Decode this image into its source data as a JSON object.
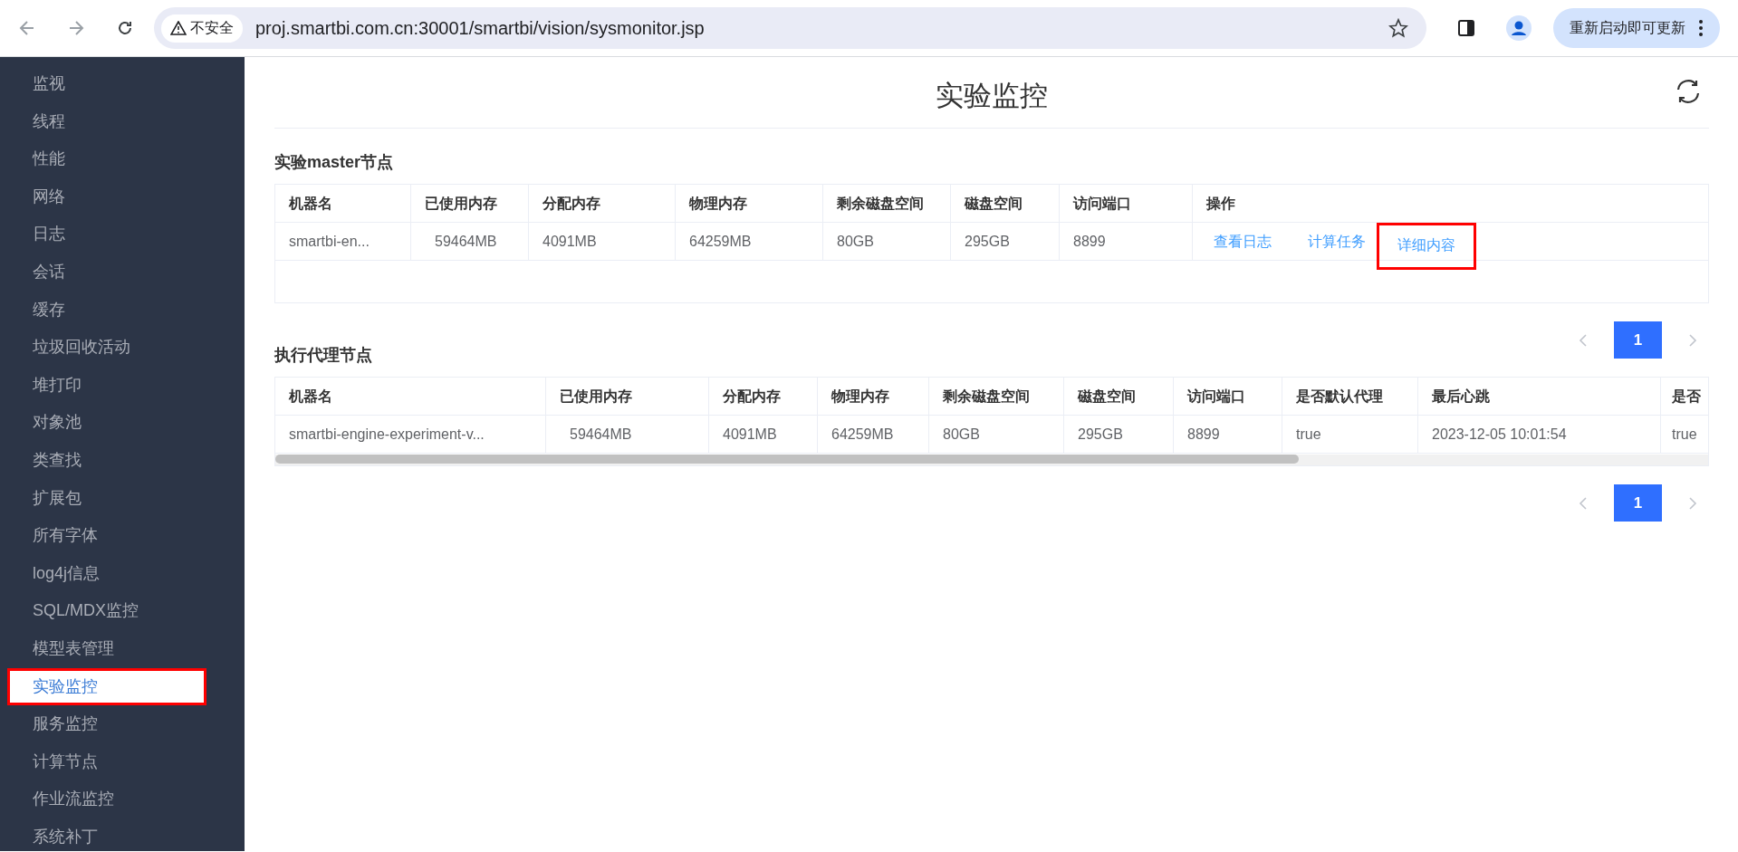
{
  "browser": {
    "security_label": "不安全",
    "url": "proj.smartbi.com.cn:30001/smartbi/vision/sysmonitor.jsp",
    "update_button": "重新启动即可更新"
  },
  "sidebar": {
    "items": [
      {
        "label": "监视",
        "selected": false
      },
      {
        "label": "线程",
        "selected": false
      },
      {
        "label": "性能",
        "selected": false
      },
      {
        "label": "网络",
        "selected": false
      },
      {
        "label": "日志",
        "selected": false
      },
      {
        "label": "会话",
        "selected": false
      },
      {
        "label": "缓存",
        "selected": false
      },
      {
        "label": "垃圾回收活动",
        "selected": false
      },
      {
        "label": "堆打印",
        "selected": false
      },
      {
        "label": "对象池",
        "selected": false
      },
      {
        "label": "类查找",
        "selected": false
      },
      {
        "label": "扩展包",
        "selected": false
      },
      {
        "label": "所有字体",
        "selected": false
      },
      {
        "label": "log4j信息",
        "selected": false
      },
      {
        "label": "SQL/MDX监控",
        "selected": false
      },
      {
        "label": "模型表管理",
        "selected": false
      },
      {
        "label": "实验监控",
        "selected": true,
        "highlighted": true
      },
      {
        "label": "服务监控",
        "selected": false
      },
      {
        "label": "计算节点",
        "selected": false
      },
      {
        "label": "作业流监控",
        "selected": false
      },
      {
        "label": "系统补丁",
        "selected": false
      }
    ]
  },
  "page_title": "实验监控",
  "master_section": {
    "title": "实验master节点",
    "columns": [
      "机器名",
      "已使用内存",
      "分配内存",
      "物理内存",
      "剩余磁盘空间",
      "磁盘空间",
      "访问端口",
      "操作"
    ],
    "rows": [
      {
        "cells": [
          "smartbi-en...",
          "59464MB",
          "4091MB",
          "64259MB",
          "80GB",
          "295GB",
          "8899"
        ],
        "actions": [
          {
            "label": "查看日志",
            "highlighted": false
          },
          {
            "label": "计算任务",
            "highlighted": false
          },
          {
            "label": "详细内容",
            "highlighted": true
          }
        ]
      }
    ],
    "pagination": {
      "pages": [
        {
          "label": "1",
          "selected": true
        }
      ]
    }
  },
  "agent_section": {
    "title": "执行代理节点",
    "columns": [
      "机器名",
      "已使用内存",
      "分配内存",
      "物理内存",
      "剩余磁盘空间",
      "磁盘空间",
      "访问端口",
      "是否默认代理",
      "最后心跳",
      "是否"
    ],
    "rows": [
      {
        "cells": [
          "smartbi-engine-experiment-v...",
          "59464MB",
          "4091MB",
          "64259MB",
          "80GB",
          "295GB",
          "8899",
          "true",
          "2023-12-05 10:01:54",
          "true"
        ]
      }
    ],
    "pagination": {
      "pages": [
        {
          "label": "1",
          "selected": true
        }
      ]
    }
  }
}
